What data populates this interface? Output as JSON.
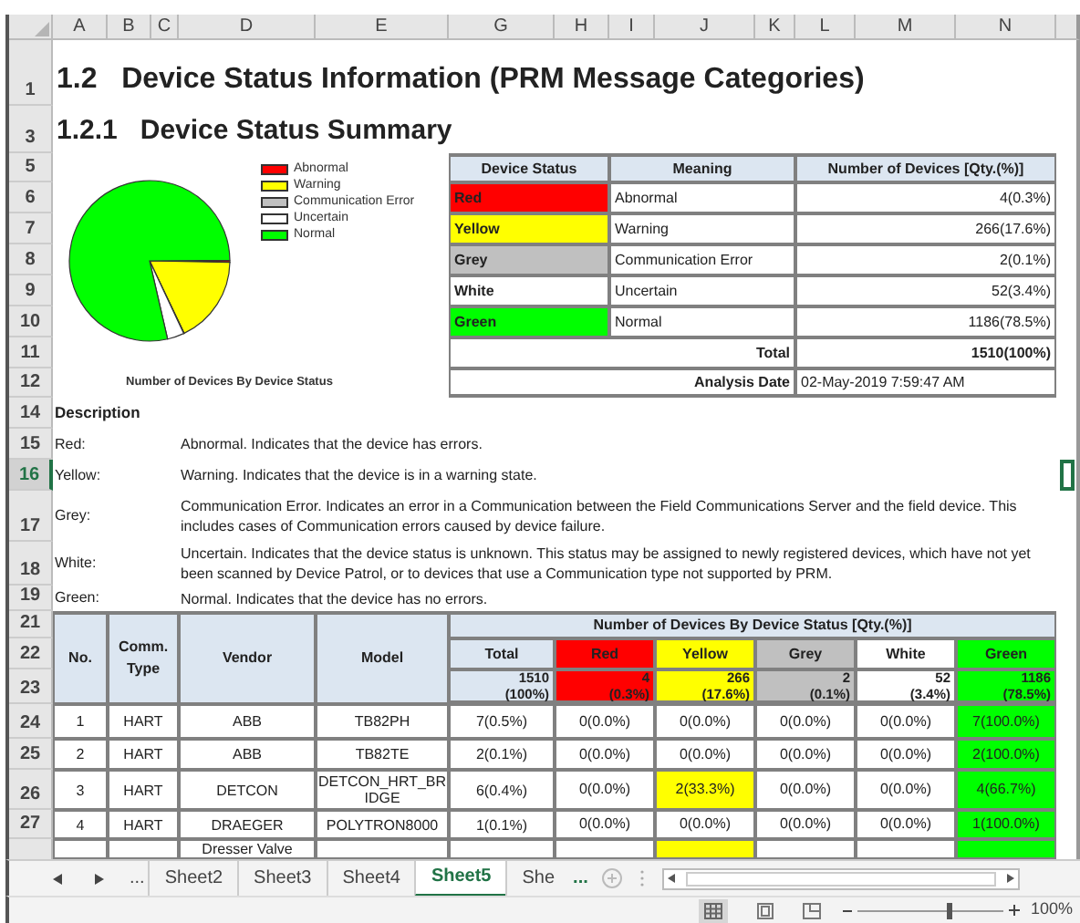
{
  "column_headers": [
    "A",
    "B",
    "C",
    "D",
    "E",
    "G",
    "H",
    "I",
    "J",
    "K",
    "L",
    "M",
    "N"
  ],
  "row_headers": [
    {
      "label": "1",
      "selected": false
    },
    {
      "label": "3",
      "selected": false
    },
    {
      "label": "5",
      "selected": false
    },
    {
      "label": "6",
      "selected": false
    },
    {
      "label": "7",
      "selected": false
    },
    {
      "label": "8",
      "selected": false
    },
    {
      "label": "9",
      "selected": false
    },
    {
      "label": "10",
      "selected": false
    },
    {
      "label": "11",
      "selected": false
    },
    {
      "label": "12",
      "selected": false
    },
    {
      "label": "14",
      "selected": false
    },
    {
      "label": "15",
      "selected": false
    },
    {
      "label": "16",
      "selected": true
    },
    {
      "label": "17",
      "selected": false
    },
    {
      "label": "18",
      "selected": false
    },
    {
      "label": "19",
      "selected": false
    },
    {
      "label": "21",
      "selected": false
    },
    {
      "label": "22",
      "selected": false
    },
    {
      "label": "23",
      "selected": false
    },
    {
      "label": "24",
      "selected": false
    },
    {
      "label": "25",
      "selected": false
    },
    {
      "label": "26",
      "selected": false
    },
    {
      "label": "27",
      "selected": false
    }
  ],
  "heading_1": "1.2   Device Status Information (PRM Message Categories)",
  "heading_2": "1.2.1   Device Status Summary",
  "pie_chart": {
    "title": "Number of Devices By Device Status",
    "legend": [
      {
        "label": "Abnormal",
        "color": "#ff0000"
      },
      {
        "label": "Warning",
        "color": "#ffff00"
      },
      {
        "label": "Communication Error",
        "color": "#c0c0c0"
      },
      {
        "label": "Uncertain",
        "color": "#ffffff"
      },
      {
        "label": "Normal",
        "color": "#00ff00"
      }
    ]
  },
  "summary_table": {
    "columns": [
      "Device Status",
      "Meaning",
      "Number of Devices [Qty.(%)]"
    ],
    "rows": [
      {
        "status": "Red",
        "color": "#ff0000",
        "meaning": "Abnormal",
        "count": "4(0.3%)"
      },
      {
        "status": "Yellow",
        "color": "#ffff00",
        "meaning": "Warning",
        "count": "266(17.6%)"
      },
      {
        "status": "Grey",
        "color": "#c0c0c0",
        "meaning": "Communication Error",
        "count": "2(0.1%)"
      },
      {
        "status": "White",
        "color": "#ffffff",
        "meaning": "Uncertain",
        "count": "52(3.4%)"
      },
      {
        "status": "Green",
        "color": "#00ff00",
        "meaning": "Normal",
        "count": "1186(78.5%)"
      }
    ],
    "total_label": "Total",
    "total": "1510(100%)",
    "date_label": "Analysis Date",
    "date": "02-May-2019 7:59:47 AM"
  },
  "description": {
    "title": "Description",
    "items": [
      {
        "label": "Red:",
        "text": "Abnormal. Indicates that the device has errors."
      },
      {
        "label": "Yellow:",
        "text": "Warning. Indicates that the device is in a warning state."
      },
      {
        "label": "Grey:",
        "text": "Communication Error. Indicates an error in a Communication between the Field Communications Server and the field device. This includes cases of Communication errors caused by device failure."
      },
      {
        "label": "White:",
        "text": "Uncertain. Indicates that the device status is unknown. This status may be assigned to newly registered devices, which have not yet been scanned by Device Patrol, or to devices that use a Communication type not supported by PRM."
      },
      {
        "label": "Green:",
        "text": "Normal. Indicates that the device has no errors."
      }
    ]
  },
  "device_table": {
    "headers": {
      "no": "No.",
      "comm": "Comm. Type",
      "vendor": "Vendor",
      "model": "Model",
      "group": "Number of Devices By Device Status [Qty.(%)]"
    },
    "status_columns": [
      {
        "label": "Total",
        "color": "#dce6f1",
        "qty": "1510",
        "pct": "(100%)"
      },
      {
        "label": "Red",
        "color": "#ff0000",
        "qty": "4",
        "pct": "(0.3%)"
      },
      {
        "label": "Yellow",
        "color": "#ffff00",
        "qty": "266",
        "pct": "(17.6%)"
      },
      {
        "label": "Grey",
        "color": "#c0c0c0",
        "qty": "2",
        "pct": "(0.1%)"
      },
      {
        "label": "White",
        "color": "#ffffff",
        "qty": "52",
        "pct": "(3.4%)"
      },
      {
        "label": "Green",
        "color": "#00ff00",
        "qty": "1186",
        "pct": "(78.5%)"
      }
    ],
    "rows": [
      {
        "no": "1",
        "comm": "HART",
        "vendor": "ABB",
        "model": "TB82PH",
        "total": "7(0.5%)",
        "counts": [
          {
            "text": "0(0.0%)",
            "highlighted": false
          },
          {
            "text": "0(0.0%)",
            "highlighted": false
          },
          {
            "text": "0(0.0%)",
            "highlighted": false
          },
          {
            "text": "0(0.0%)",
            "highlighted": false
          },
          {
            "text": "7(100.0%)",
            "highlighted": true
          }
        ]
      },
      {
        "no": "2",
        "comm": "HART",
        "vendor": "ABB",
        "model": "TB82TE",
        "total": "2(0.1%)",
        "counts": [
          {
            "text": "0(0.0%)",
            "highlighted": false
          },
          {
            "text": "0(0.0%)",
            "highlighted": false
          },
          {
            "text": "0(0.0%)",
            "highlighted": false
          },
          {
            "text": "0(0.0%)",
            "highlighted": false
          },
          {
            "text": "2(100.0%)",
            "highlighted": true
          }
        ]
      },
      {
        "no": "3",
        "comm": "HART",
        "vendor": "DETCON",
        "model": "DETCON_HRT_BRIDGE",
        "total": "6(0.4%)",
        "counts": [
          {
            "text": "0(0.0%)",
            "highlighted": false
          },
          {
            "text": "2(33.3%)",
            "highlighted": true
          },
          {
            "text": "0(0.0%)",
            "highlighted": false
          },
          {
            "text": "0(0.0%)",
            "highlighted": false
          },
          {
            "text": "4(66.7%)",
            "highlighted": true
          }
        ]
      },
      {
        "no": "4",
        "comm": "HART",
        "vendor": "DRAEGER",
        "model": "POLYTRON8000",
        "total": "1(0.1%)",
        "counts": [
          {
            "text": "0(0.0%)",
            "highlighted": false
          },
          {
            "text": "0(0.0%)",
            "highlighted": false
          },
          {
            "text": "0(0.0%)",
            "highlighted": false
          },
          {
            "text": "0(0.0%)",
            "highlighted": false
          },
          {
            "text": "1(100.0%)",
            "highlighted": true
          }
        ]
      },
      {
        "vendor": "Dresser Valve",
        "counts": [
          {
            "highlighted": false
          },
          {
            "highlighted": true
          },
          {
            "highlighted": false
          },
          {
            "highlighted": false
          },
          {
            "highlighted": true
          }
        ]
      }
    ]
  },
  "sheet_tabs": {
    "overflow_left": "...",
    "tabs": [
      {
        "label": "Sheet2",
        "selected": false
      },
      {
        "label": "Sheet3",
        "selected": false
      },
      {
        "label": "Sheet4",
        "selected": false
      },
      {
        "label": "Sheet5",
        "selected": true
      },
      {
        "label": "She",
        "selected": false
      }
    ],
    "overflow_right": "..."
  },
  "status_bar": {
    "zoom_slider": {
      "level": 0.62
    },
    "zoom": "100%"
  }
}
